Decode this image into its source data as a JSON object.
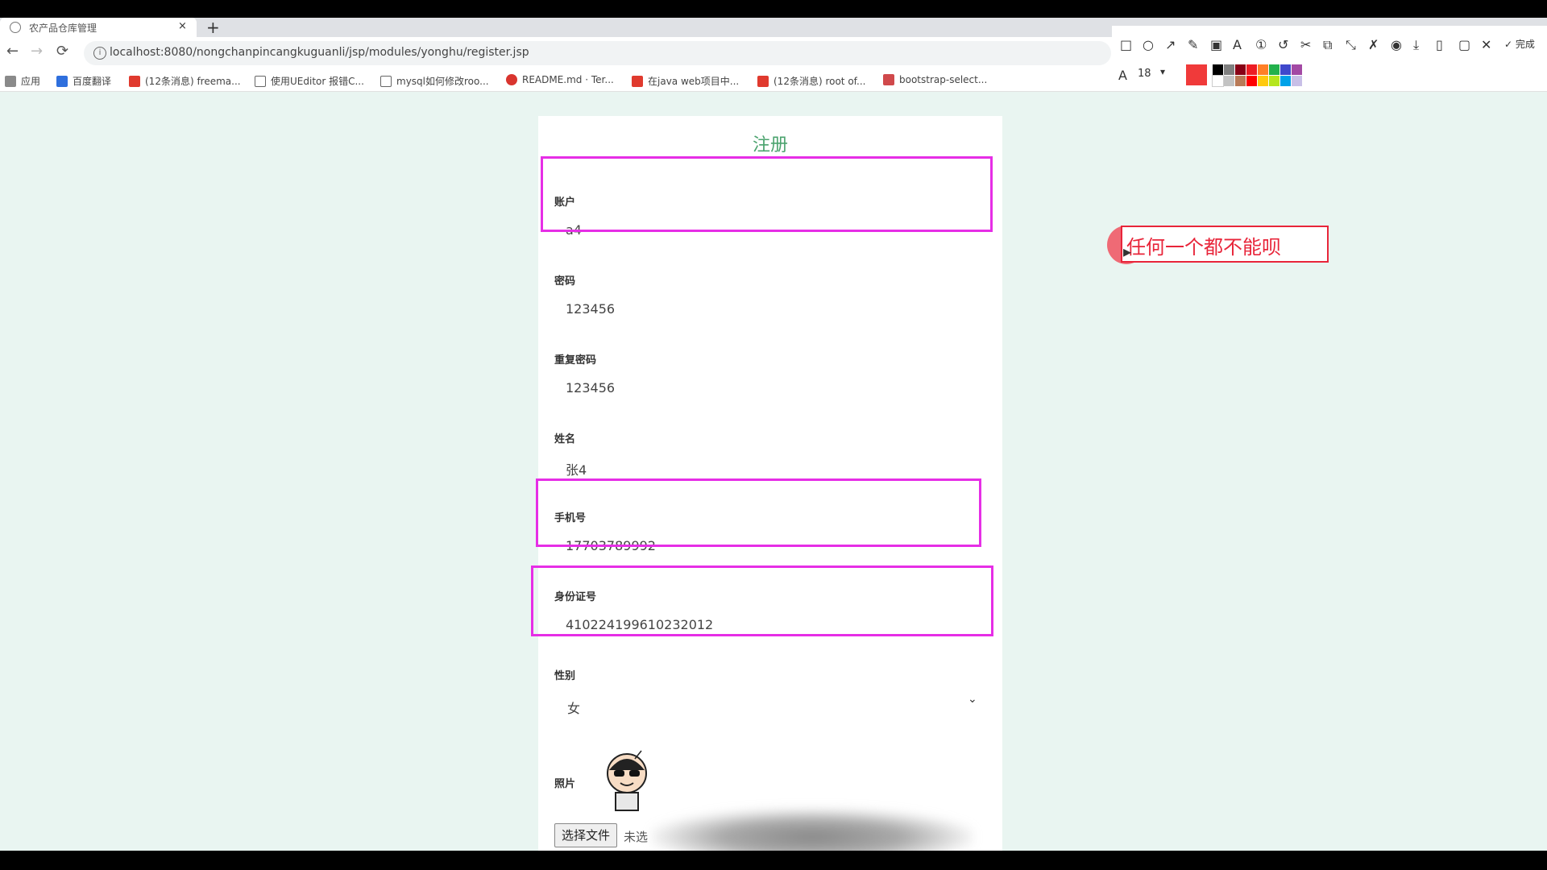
{
  "browser": {
    "tab_title": "农产品仓库管理",
    "tab_close": "×",
    "new_tab": "+",
    "url": "localhost:8080/nongchanpincangkuguanli/jsp/modules/yonghu/register.jsp",
    "nav_back": "←",
    "nav_forward": "→",
    "nav_reload": "⟳",
    "info_icon": "i",
    "bookmarks": [
      {
        "label": "应用",
        "color": "#4a86e8"
      },
      {
        "label": "百度翻译",
        "color": "#2f6fdd"
      },
      {
        "label": "(12条消息) freema...",
        "color": "#e03a2e"
      },
      {
        "label": "使用UEditor 报错C...",
        "color": "#666666"
      },
      {
        "label": "mysql如何修改roo...",
        "color": "#666666"
      },
      {
        "label": "README.md · Ter...",
        "color": "#d9352f"
      },
      {
        "label": "在java web项目中...",
        "color": "#e03a2e"
      },
      {
        "label": "(12条消息) root of...",
        "color": "#e03a2e"
      },
      {
        "label": "bootstrap-select...",
        "color": "#d0494b"
      }
    ],
    "star_icon": "☆",
    "profile_icon": "●",
    "menu_icon": "⋮"
  },
  "annotation_toolbar": {
    "tools": [
      "□",
      "○",
      "↗",
      "✎",
      "▣",
      "A",
      "①",
      "↺",
      "✂",
      "⧉",
      "⤡",
      "✗",
      "◉",
      "⤓",
      "▯",
      "▢",
      "✕"
    ],
    "finish_label": "✓ 完成",
    "font_icon": "A",
    "font_size": "18",
    "font_dropdown": "▾",
    "current_color": "#f03a3a",
    "palette": [
      "#000000",
      "#7f7f7f",
      "#880015",
      "#ed1c24",
      "#ff7f27",
      "#22b14c",
      "#3f48cc",
      "#a349a4",
      "#ffffff",
      "#c3c3c3",
      "#b97a57",
      "#ff0000",
      "#ffc90e",
      "#b5e61d",
      "#00a2e8",
      "#c8bfe7"
    ]
  },
  "form": {
    "title": "注册",
    "fields": [
      {
        "label": "账户",
        "value": "a4"
      },
      {
        "label": "密码",
        "value": "123456"
      },
      {
        "label": "重复密码",
        "value": "123456"
      },
      {
        "label": "姓名",
        "value": "张4"
      },
      {
        "label": "手机号",
        "value": "17703789992"
      },
      {
        "label": "身份证号",
        "value": "410224199610232012"
      },
      {
        "label": "性别",
        "value": "女"
      }
    ],
    "select_arrow": "⌄",
    "photo_label": "照片",
    "file_button": "选择文件",
    "file_status": "未选"
  },
  "annotation": {
    "text": "任何一个都不能呗",
    "box_color": "#e8253a",
    "highlight_color": "#e62ee6"
  }
}
